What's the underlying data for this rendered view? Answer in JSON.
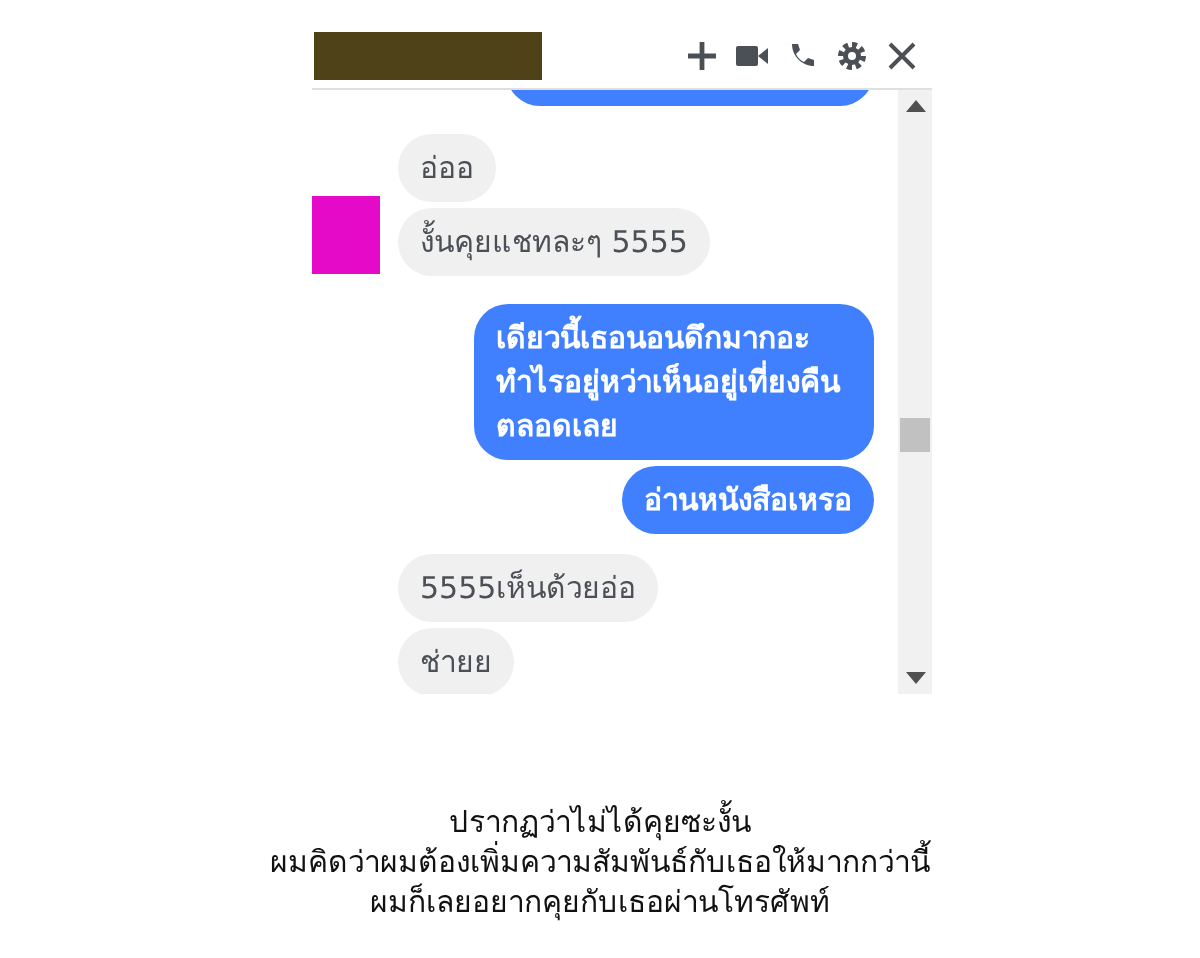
{
  "chat": {
    "messages": [
      {
        "kind": "incoming",
        "texts": [
          "อ่ออ",
          "งั้นคุยแชทละๆ 5555"
        ]
      },
      {
        "kind": "outgoing",
        "texts": [
          "เดียวนี้เธอนอนดึกมากอะ ทำไรอยู่หว่าเห็นอยู่เที่ยงคืนตลอดเลย",
          "อ่านหนังสือเหรอ"
        ]
      },
      {
        "kind": "incoming",
        "texts": [
          "5555เห็นด้วยอ่อ",
          "ช่ายย"
        ]
      }
    ]
  },
  "caption": [
    "ปรากฏว่าไม่ได้คุยซะงั้น",
    "ผมคิดว่าผมต้องเพิ่มความสัมพันธ์กับเธอให้มากกว่านี้",
    "ผมก็เลยอยากคุยกับเธอผ่านโทรศัพท์"
  ]
}
